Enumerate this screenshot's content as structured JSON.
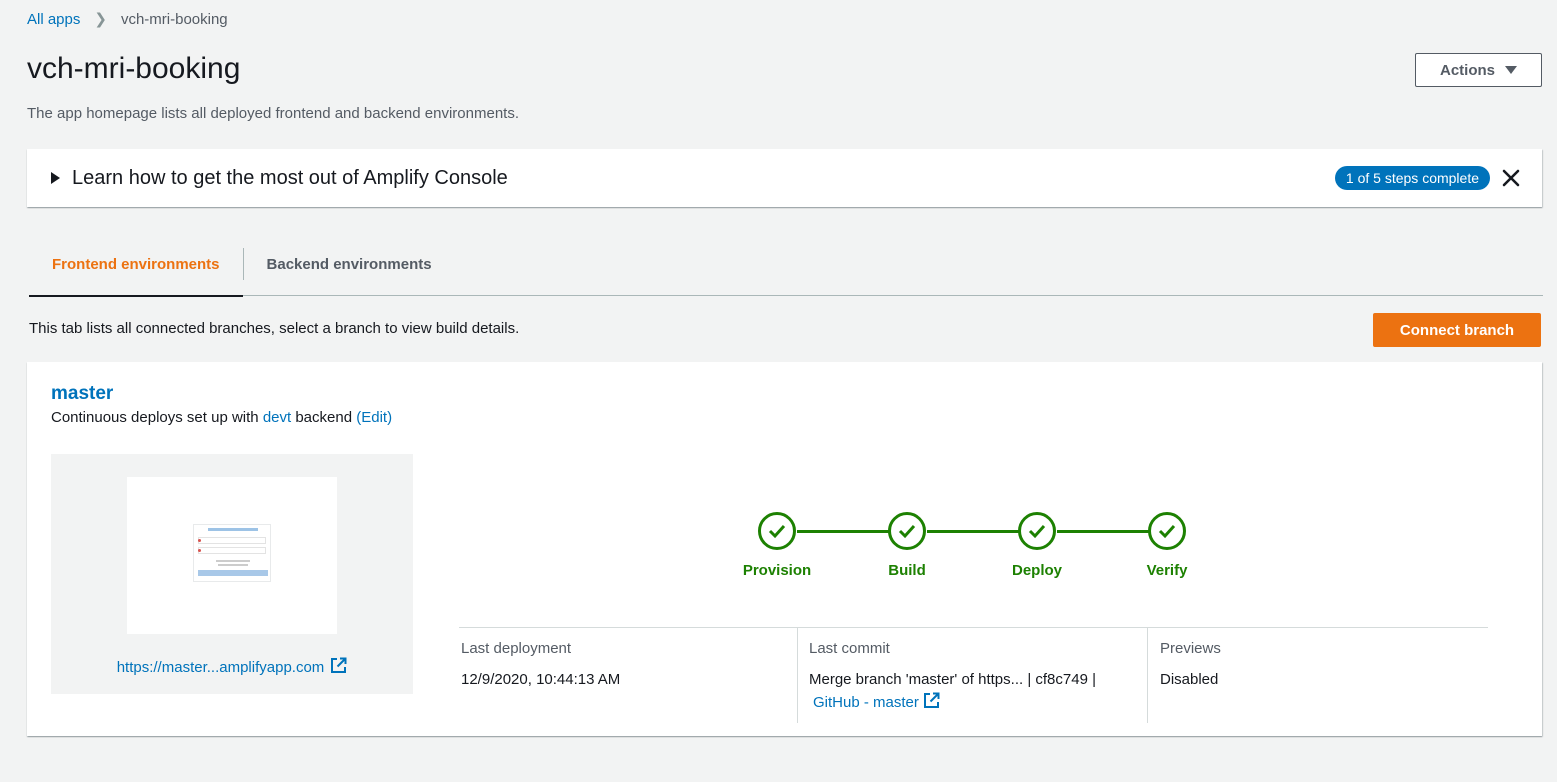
{
  "breadcrumb": {
    "root": "All apps",
    "current": "vch-mri-booking"
  },
  "header": {
    "title": "vch-mri-booking",
    "actions_label": "Actions",
    "description": "The app homepage lists all deployed frontend and backend environments."
  },
  "learn_panel": {
    "text": "Learn how to get the most out of Amplify Console",
    "badge": "1 of 5 steps complete"
  },
  "tabs": [
    {
      "label": "Frontend environments",
      "active": true
    },
    {
      "label": "Backend environments",
      "active": false
    }
  ],
  "tab_description": "This tab lists all connected branches, select a branch to view build details.",
  "connect_branch_label": "Connect branch",
  "branch": {
    "name": "master",
    "sub_prefix": "Continuous deploys set up with",
    "backend_env": "devt",
    "sub_suffix": "backend",
    "edit_label": "(Edit)",
    "preview_url": "https://master...amplifyapp.com",
    "pipeline": [
      {
        "label": "Provision",
        "status": "complete"
      },
      {
        "label": "Build",
        "status": "complete"
      },
      {
        "label": "Deploy",
        "status": "complete"
      },
      {
        "label": "Verify",
        "status": "complete"
      }
    ],
    "last_deployment": {
      "label": "Last deployment",
      "value": "12/9/2020, 10:44:13 AM"
    },
    "last_commit": {
      "label": "Last commit",
      "message": "Merge branch 'master' of https... | cf8c749 |",
      "repo_link": "GitHub - master"
    },
    "previews": {
      "label": "Previews",
      "value": "Disabled"
    }
  },
  "colors": {
    "accent": "#ec7211",
    "link": "#0073bb",
    "success": "#1d8102"
  }
}
